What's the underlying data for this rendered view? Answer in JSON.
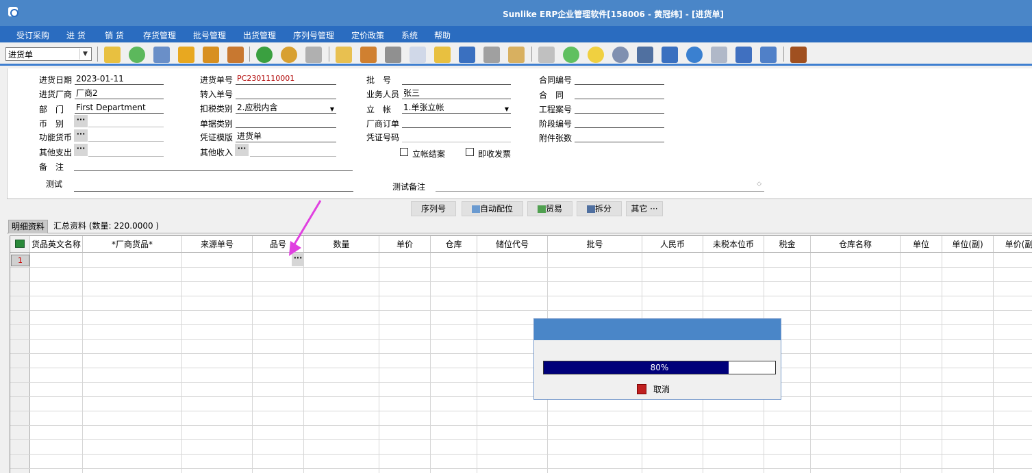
{
  "window": {
    "title": "Sunlike ERP企业管理软件[158006 - 黄冠纬] - [进货单]"
  },
  "menu": [
    "受订采购",
    "进 货",
    "销 货",
    "存货管理",
    "批号管理",
    "出货管理",
    "序列号管理",
    "定价政策",
    "系统",
    "帮助"
  ],
  "toolbar": {
    "doc_type": "进货单"
  },
  "form": {
    "date_label": "进货日期",
    "date": "2023-01-11",
    "vendor_label": "进货厂商",
    "vendor": "厂商2",
    "dept_label": "部　门",
    "dept": "First Department",
    "currency_label": "币　别",
    "func_currency_label": "功能货币",
    "other_expense_label": "其他支出",
    "note_label": "备　注",
    "test_label": "测试",
    "order_no_label": "进货单号",
    "order_no": "PC2301110001",
    "transfer_no_label": "转入单号",
    "tax_type_label": "扣税类别",
    "tax_type": "2.应税内含",
    "doc_class_label": "单据类别",
    "voucher_tpl_label": "凭证模版",
    "voucher_tpl": "进货单",
    "other_income_label": "其他收入",
    "batch_label": "批　号",
    "salesperson_label": "业务人员",
    "salesperson": "张三",
    "account_label": "立　帐",
    "account": "1.单张立帐",
    "vendor_order_label": "厂商订单",
    "voucher_no_label": "凭证号码",
    "close_account_label": "立帐结案",
    "receive_invoice_label": "即收发票",
    "test_note_label": "测试备注",
    "contract_no_label": "合同编号",
    "contract_label": "合　同",
    "project_no_label": "工程案号",
    "stage_no_label": "阶段编号",
    "attachments_label": "附件张数"
  },
  "buttons": {
    "serial": "序列号",
    "auto_alloc": "自动配位",
    "trade": "贸易",
    "split": "拆分",
    "other": "其它 ···"
  },
  "tabs": {
    "detail": "明细资料",
    "summary": "汇总资料 (数量: 220.0000 )"
  },
  "grid": {
    "columns": [
      "货品英文名称",
      "*厂商货品*",
      "来源单号",
      "品号",
      "数量",
      "单价",
      "仓库",
      "储位代号",
      "批号",
      "人民币",
      "未税本位币",
      "税金",
      "仓库名称",
      "单位",
      "单位(副)",
      "单价(副"
    ],
    "row_number": "1"
  },
  "dialog": {
    "progress_text": "80%",
    "progress": 0.8,
    "cancel_label": "取消"
  },
  "colors": {
    "titlebar": "#4a86c8",
    "menubar": "#2a6cc0",
    "progress": "#00007a",
    "arrow": "#e040e0"
  }
}
